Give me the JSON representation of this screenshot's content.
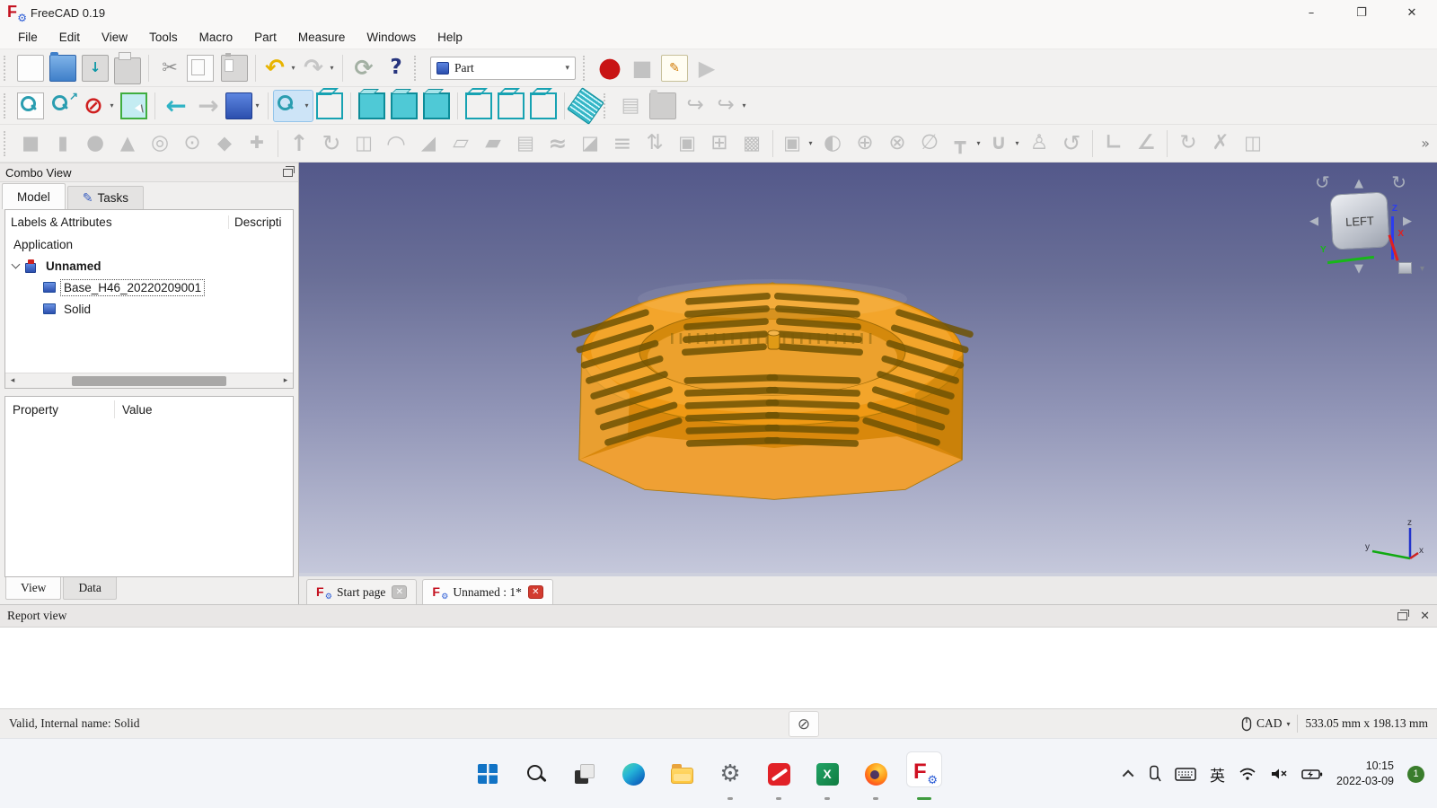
{
  "ui": {
    "dropdown": "▾",
    "close": "✕",
    "scroll_left": "◂",
    "scroll_right": "▸"
  },
  "window": {
    "title": "FreeCAD 0.19",
    "minimize": "–",
    "maximize": "❐",
    "close": "✕"
  },
  "menu": {
    "items": [
      "File",
      "Edit",
      "View",
      "Tools",
      "Macro",
      "Part",
      "Measure",
      "Windows",
      "Help"
    ]
  },
  "toolbars": {
    "workbench": {
      "value": "Part"
    },
    "row1": [
      {
        "t": "handle"
      },
      {
        "n": "new-document",
        "cls": "ic-page"
      },
      {
        "n": "open-document",
        "cls": "ic-folder"
      },
      {
        "n": "save-document",
        "cls": "ic-save",
        "g": "↓",
        "c": "#0e98a6",
        "fs": 15
      },
      {
        "n": "print",
        "cls": "ic-print"
      },
      {
        "t": "sep"
      },
      {
        "n": "cut",
        "g": "✂",
        "c": "#8f8f8f",
        "fs": 21
      },
      {
        "n": "copy",
        "cls": "ic-copy"
      },
      {
        "n": "paste",
        "cls": "ic-paste"
      },
      {
        "t": "sep"
      },
      {
        "n": "undo",
        "g": "↶",
        "c": "#e8b400",
        "fs": 26,
        "b": 1,
        "dd": 1
      },
      {
        "n": "redo",
        "g": "↷",
        "c": "#c6c6c6",
        "fs": 26,
        "b": 1,
        "dd": 1
      },
      {
        "t": "sep"
      },
      {
        "n": "refresh",
        "g": "⟳",
        "c": "#a3b0a3",
        "fs": 25,
        "b": 1
      },
      {
        "n": "whats-this",
        "g": "?",
        "c": "#27357e",
        "fs": 23,
        "b": 1
      },
      {
        "t": "handle"
      },
      {
        "t": "combo"
      },
      {
        "t": "handle"
      },
      {
        "n": "macro-record",
        "g": "●",
        "c": "#c81414",
        "fs": 30
      },
      {
        "n": "macro-stop",
        "g": "■",
        "c": "#c2c2c2",
        "fs": 24
      },
      {
        "n": "macro-edit",
        "cls": "ic-note",
        "g": "✎",
        "c": "#d07800",
        "fs": 14
      },
      {
        "n": "macro-execute",
        "g": "▶",
        "c": "#c6c6c6",
        "fs": 24
      }
    ],
    "row2": [
      {
        "t": "handle"
      },
      {
        "n": "fit-all",
        "cls": "ic-magdoc"
      },
      {
        "n": "fit-selection",
        "cls": "ic-magsel"
      },
      {
        "n": "clipping-plane",
        "g": "⊘",
        "c": "#cf1f1f",
        "fs": 26,
        "b": 1,
        "dd": 1
      },
      {
        "n": "box-element-selection",
        "cls": "ic-boxsel"
      },
      {
        "t": "sep"
      },
      {
        "n": "navigate-back",
        "g": "←",
        "c": "#2fb3c5",
        "fs": 28,
        "b": 1
      },
      {
        "n": "navigate-forward",
        "g": "→",
        "c": "#c2c2c2",
        "fs": 28,
        "b": 1
      },
      {
        "n": "home-view",
        "cls": "ic-homecube",
        "dd": 1
      },
      {
        "t": "sep"
      },
      {
        "n": "draw-style",
        "cls": "ic-mag",
        "a": 1,
        "dd": 1
      },
      {
        "n": "axonometric-view",
        "cls": "ic-cube-wire"
      },
      {
        "t": "sep"
      },
      {
        "n": "view-front",
        "cls": "ic-cube-fill"
      },
      {
        "n": "view-top",
        "cls": "ic-cube-fill"
      },
      {
        "n": "view-right",
        "cls": "ic-cube-fill"
      },
      {
        "t": "sep"
      },
      {
        "n": "view-rear",
        "cls": "ic-cube-wire"
      },
      {
        "n": "view-bottom",
        "cls": "ic-cube-wire"
      },
      {
        "n": "view-left",
        "cls": "ic-cube-wire"
      },
      {
        "t": "sep"
      },
      {
        "n": "measure-distance",
        "cls": "ic-ruler"
      },
      {
        "t": "handle"
      },
      {
        "n": "create-part",
        "g": "▤",
        "c": "#c3c3c3",
        "fs": 22
      },
      {
        "n": "create-group",
        "cls": "ic-folder-dis"
      },
      {
        "n": "make-link",
        "g": "↪",
        "c": "#bdbdbd",
        "fs": 23
      },
      {
        "n": "make-sub-link",
        "g": "↪",
        "c": "#bdbdbd",
        "fs": 23,
        "dd": 1
      }
    ],
    "row3": [
      {
        "t": "handle"
      },
      {
        "n": "box",
        "g": "■",
        "c": "#bfbfbf",
        "fs": 21
      },
      {
        "n": "cylinder",
        "g": "▮",
        "c": "#bfbfbf",
        "fs": 21
      },
      {
        "n": "sphere",
        "g": "●",
        "c": "#bfbfbf",
        "fs": 23
      },
      {
        "n": "cone",
        "g": "▲",
        "c": "#bfbfbf",
        "fs": 21
      },
      {
        "n": "torus",
        "g": "◎",
        "c": "#bfbfbf",
        "fs": 23
      },
      {
        "n": "tube",
        "g": "⊙",
        "c": "#bfbfbf",
        "fs": 23
      },
      {
        "n": "create-primitives",
        "g": "◆",
        "c": "#bfbfbf",
        "fs": 21
      },
      {
        "n": "shape-builder",
        "g": "✚",
        "c": "#bfbfbf",
        "fs": 19
      },
      {
        "t": "sep"
      },
      {
        "n": "extrude",
        "g": "↑",
        "c": "#bfbfbf",
        "fs": 25,
        "b": 1
      },
      {
        "n": "revolve",
        "g": "↻",
        "c": "#bfbfbf",
        "fs": 25
      },
      {
        "n": "mirror",
        "g": "◫",
        "c": "#bfbfbf",
        "fs": 21
      },
      {
        "n": "fillet",
        "g": "◠",
        "c": "#bfbfbf",
        "fs": 25,
        "b": 1
      },
      {
        "n": "chamfer",
        "g": "◢",
        "c": "#bfbfbf",
        "fs": 21
      },
      {
        "n": "make-face",
        "g": "▱",
        "c": "#bfbfbf",
        "fs": 23
      },
      {
        "n": "ruled-surface",
        "g": "▰",
        "c": "#bfbfbf",
        "fs": 23
      },
      {
        "n": "loft",
        "g": "▤",
        "c": "#bfbfbf",
        "fs": 21
      },
      {
        "n": "sweep",
        "g": "≈",
        "c": "#bfbfbf",
        "fs": 25,
        "b": 1
      },
      {
        "n": "section",
        "g": "◪",
        "c": "#bfbfbf",
        "fs": 21
      },
      {
        "n": "cross-sections",
        "g": "≡",
        "c": "#bfbfbf",
        "fs": 25
      },
      {
        "n": "offset-3d",
        "g": "⇅",
        "c": "#bfbfbf",
        "fs": 23
      },
      {
        "n": "offset-2d",
        "g": "▣",
        "c": "#bfbfbf",
        "fs": 21
      },
      {
        "n": "thickness",
        "g": "⊞",
        "c": "#bfbfbf",
        "fs": 23
      },
      {
        "n": "convert-to-solid",
        "g": "▩",
        "c": "#bfbfbf",
        "fs": 21
      },
      {
        "t": "sep"
      },
      {
        "n": "compound-tools",
        "g": "▣",
        "c": "#bfbfbf",
        "fs": 21,
        "dd": 1
      },
      {
        "n": "boolean-cut",
        "g": "◐",
        "c": "#bfbfbf",
        "fs": 23
      },
      {
        "n": "boolean-union",
        "g": "⊕",
        "c": "#bfbfbf",
        "fs": 23
      },
      {
        "n": "boolean-intersection",
        "g": "⊗",
        "c": "#bfbfbf",
        "fs": 23
      },
      {
        "n": "boolean-xor",
        "g": "∅",
        "c": "#bfbfbf",
        "fs": 23
      },
      {
        "n": "join-features",
        "g": "┳",
        "c": "#bfbfbf",
        "fs": 21,
        "dd": 1
      },
      {
        "n": "connect-objects",
        "g": "∪",
        "c": "#bfbfbf",
        "fs": 23,
        "b": 1,
        "dd": 1
      },
      {
        "n": "check-geometry",
        "g": "♙",
        "c": "#bfbfbf",
        "fs": 23
      },
      {
        "n": "defeaturing",
        "g": "↺",
        "c": "#bfbfbf",
        "fs": 25
      },
      {
        "t": "sep"
      },
      {
        "n": "measure-linear",
        "g": "∟",
        "c": "#bfbfbf",
        "fs": 23,
        "b": 1
      },
      {
        "n": "measure-angular",
        "g": "∠",
        "c": "#bfbfbf",
        "fs": 23,
        "b": 1
      },
      {
        "t": "sep"
      },
      {
        "n": "measure-refresh",
        "g": "↻",
        "c": "#bfbfbf",
        "fs": 23
      },
      {
        "n": "measure-clear",
        "g": "✗",
        "c": "#bfbfbf",
        "fs": 23
      },
      {
        "n": "measure-toggle",
        "g": "◫",
        "c": "#bfbfbf",
        "fs": 21
      },
      {
        "t": "overflow",
        "g": "»"
      }
    ]
  },
  "combo_view": {
    "title": "Combo View",
    "tabs": [
      {
        "label": "Model",
        "active": true
      },
      {
        "label": "Tasks",
        "icon": "pencil"
      }
    ],
    "tree": {
      "columns": [
        "Labels & Attributes",
        "Descripti"
      ],
      "root": "Application",
      "document": {
        "label": "Unnamed",
        "expanded": true
      },
      "children": [
        {
          "label": "Base_H46_20220209001",
          "selected": true
        },
        {
          "label": "Solid",
          "selected": false
        }
      ]
    },
    "properties": {
      "columns": [
        "Property",
        "Value"
      ],
      "rows": []
    },
    "bottom_tabs": [
      {
        "label": "View",
        "active": true
      },
      {
        "label": "Data",
        "active": false
      }
    ]
  },
  "viewport": {
    "nav_cube": {
      "face": "LEFT",
      "axes": {
        "x": "X",
        "y": "Y",
        "z": "Z"
      }
    },
    "mini_axes": {
      "x": "x",
      "y": "y",
      "z": "z"
    },
    "mdi_tabs": [
      {
        "label": "Start page",
        "active": false
      },
      {
        "label": "Unnamed : 1*",
        "active": true
      }
    ],
    "model_color": "#ef9914"
  },
  "report_view": {
    "title": "Report view"
  },
  "status_bar": {
    "message": "Valid, Internal name: Solid",
    "abort_glyph": "⊘",
    "nav_style": "CAD",
    "dimensions": "533.05 mm x 198.13 mm"
  },
  "taskbar": {
    "pinned": [
      {
        "n": "start",
        "run": 0,
        "active": 0
      },
      {
        "n": "search",
        "run": 0,
        "active": 0
      },
      {
        "n": "task-view",
        "run": 0,
        "active": 0
      },
      {
        "n": "edge",
        "run": 0,
        "active": 0
      },
      {
        "n": "file-explorer",
        "run": 0,
        "active": 0
      },
      {
        "n": "settings",
        "run": 1,
        "active": 0
      },
      {
        "n": "sketchup",
        "run": 1,
        "active": 0
      },
      {
        "n": "excel",
        "run": 1,
        "active": 0
      },
      {
        "n": "firefox",
        "run": 1,
        "active": 0
      },
      {
        "n": "freecad",
        "run": 1,
        "active": 1
      }
    ],
    "tray": {
      "ime": "英",
      "time": "10:15",
      "date": "2022-03-09",
      "badge": "1"
    }
  }
}
